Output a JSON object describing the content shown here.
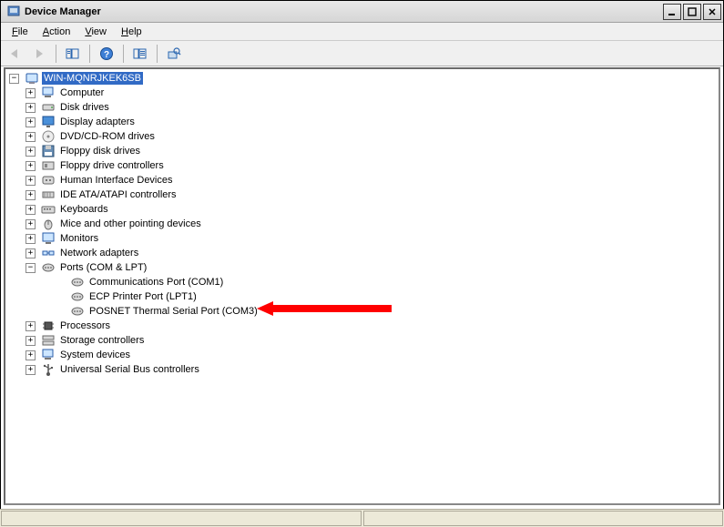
{
  "window": {
    "title": "Device Manager"
  },
  "menu": {
    "file": "File",
    "action": "Action",
    "view": "View",
    "help": "Help"
  },
  "toolbar": {
    "back": "Back",
    "forward": "Forward",
    "show_hide": "Show/Hide Console Tree",
    "help": "Help",
    "properties": "Properties",
    "scan": "Scan for hardware changes"
  },
  "tree": {
    "root": "WIN-MQNRJKEK6SB",
    "nodes": [
      {
        "label": "Computer",
        "icon": "computer-icon",
        "expandable": true
      },
      {
        "label": "Disk drives",
        "icon": "disk-icon",
        "expandable": true
      },
      {
        "label": "Display adapters",
        "icon": "display-icon",
        "expandable": true
      },
      {
        "label": "DVD/CD-ROM drives",
        "icon": "cdrom-icon",
        "expandable": true
      },
      {
        "label": "Floppy disk drives",
        "icon": "floppy-icon",
        "expandable": true
      },
      {
        "label": "Floppy drive controllers",
        "icon": "floppy-ctrl-icon",
        "expandable": true
      },
      {
        "label": "Human Interface Devices",
        "icon": "hid-icon",
        "expandable": true
      },
      {
        "label": "IDE ATA/ATAPI controllers",
        "icon": "ide-icon",
        "expandable": true
      },
      {
        "label": "Keyboards",
        "icon": "keyboard-icon",
        "expandable": true
      },
      {
        "label": "Mice and other pointing devices",
        "icon": "mouse-icon",
        "expandable": true
      },
      {
        "label": "Monitors",
        "icon": "monitor-icon",
        "expandable": true
      },
      {
        "label": "Network adapters",
        "icon": "network-icon",
        "expandable": true
      },
      {
        "label": "Ports (COM & LPT)",
        "icon": "port-icon",
        "expandable": true,
        "expanded": true,
        "children": [
          {
            "label": "Communications Port (COM1)",
            "icon": "port-icon"
          },
          {
            "label": "ECP Printer Port (LPT1)",
            "icon": "port-icon"
          },
          {
            "label": "POSNET Thermal Serial Port (COM3)",
            "icon": "port-icon",
            "highlighted": true
          }
        ]
      },
      {
        "label": "Processors",
        "icon": "cpu-icon",
        "expandable": true
      },
      {
        "label": "Storage controllers",
        "icon": "storage-icon",
        "expandable": true
      },
      {
        "label": "System devices",
        "icon": "system-icon",
        "expandable": true
      },
      {
        "label": "Universal Serial Bus controllers",
        "icon": "usb-icon",
        "expandable": true
      }
    ]
  }
}
